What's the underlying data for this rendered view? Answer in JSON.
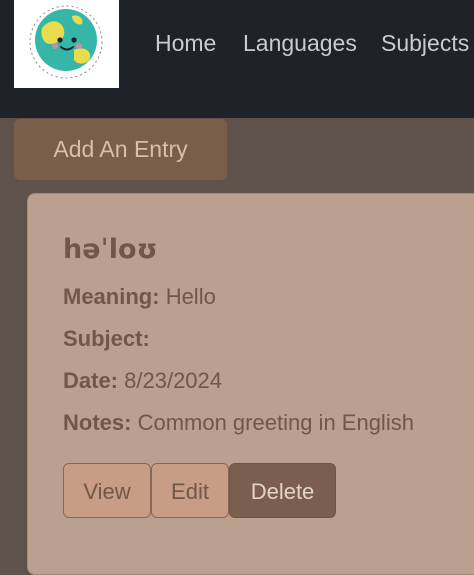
{
  "nav": {
    "logo_icon": "globe-logo-icon",
    "links": [
      "Home",
      "Languages",
      "Subjects"
    ]
  },
  "toolbar": {
    "add_label": "Add An Entry"
  },
  "entry": {
    "word": "həˈloʊ",
    "meaning_label": "Meaning:",
    "meaning_value": "Hello",
    "subject_label": "Subject:",
    "subject_value": "",
    "date_label": "Date:",
    "date_value": "8/23/2024",
    "notes_label": "Notes:",
    "notes_value": "Common greeting in English",
    "view_label": "View",
    "edit_label": "Edit",
    "delete_label": "Delete"
  },
  "colors": {
    "navbar": "#1f2229",
    "background": "#5f524a",
    "card": "#b9a08f",
    "accent_button": "#c89d85",
    "danger_button": "#7a5e4e"
  }
}
